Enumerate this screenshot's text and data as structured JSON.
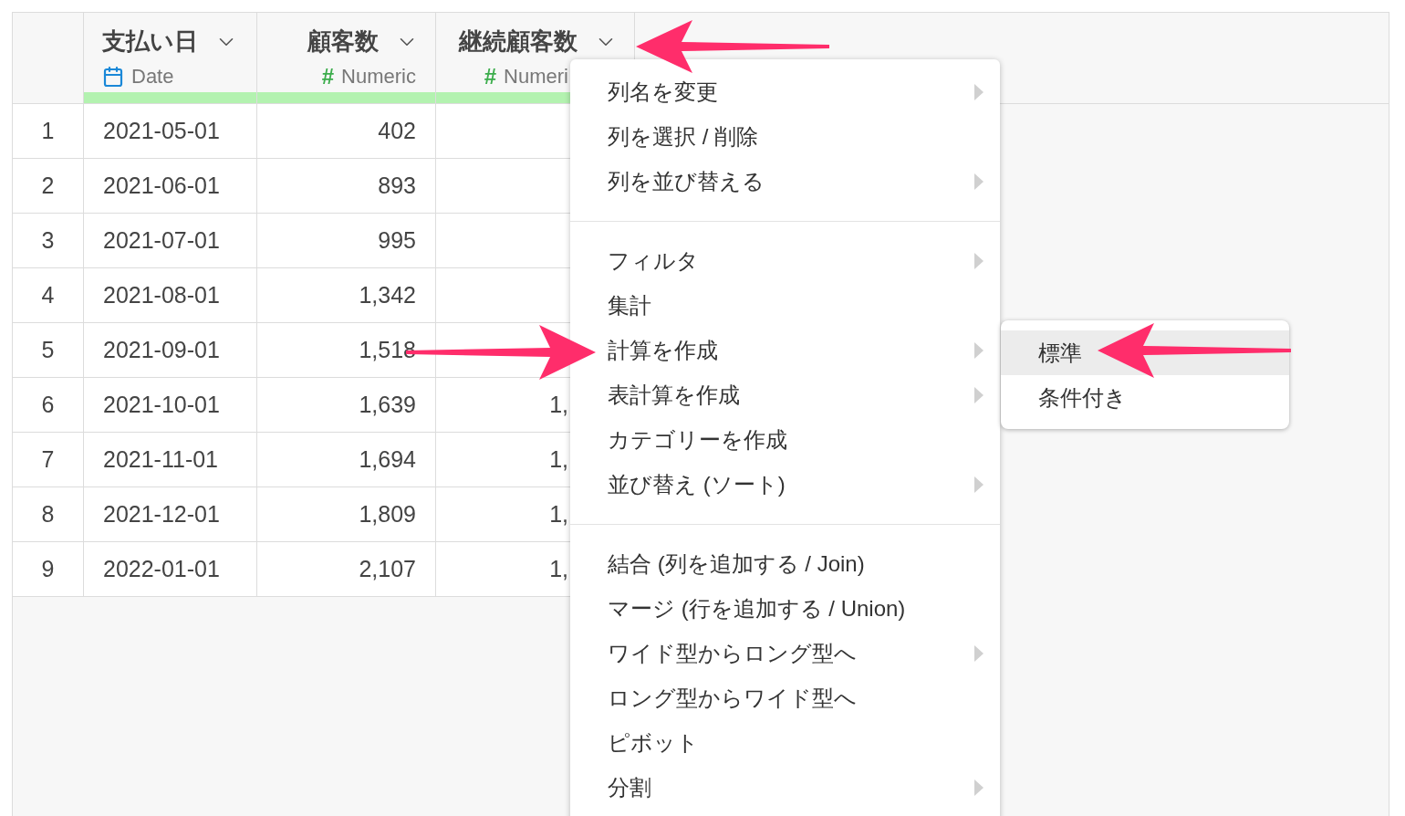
{
  "table": {
    "columns": [
      {
        "name": "支払い日",
        "type_label": "Date",
        "kind": "date"
      },
      {
        "name": "顧客数",
        "type_label": "Numeric",
        "kind": "numeric",
        "symbol": "#"
      },
      {
        "name": "継続顧客数",
        "type_label": "Numeri",
        "kind": "numeric",
        "symbol": "#"
      }
    ],
    "rows": [
      {
        "index": "1",
        "cells": [
          "2021-05-01",
          "402",
          ""
        ]
      },
      {
        "index": "2",
        "cells": [
          "2021-06-01",
          "893",
          ""
        ]
      },
      {
        "index": "3",
        "cells": [
          "2021-07-01",
          "995",
          ""
        ]
      },
      {
        "index": "4",
        "cells": [
          "2021-08-01",
          "1,342",
          ""
        ]
      },
      {
        "index": "5",
        "cells": [
          "2021-09-01",
          "1,518",
          ""
        ]
      },
      {
        "index": "6",
        "cells": [
          "2021-10-01",
          "1,639",
          "1,"
        ]
      },
      {
        "index": "7",
        "cells": [
          "2021-11-01",
          "1,694",
          "1,"
        ]
      },
      {
        "index": "8",
        "cells": [
          "2021-12-01",
          "1,809",
          "1,"
        ]
      },
      {
        "index": "9",
        "cells": [
          "2022-01-01",
          "2,107",
          "1,"
        ]
      }
    ]
  },
  "context_menu": {
    "groups": [
      [
        {
          "label": "列名を変更",
          "submenu": true
        },
        {
          "label": "列を選択 / 削除",
          "submenu": false
        },
        {
          "label": "列を並び替える",
          "submenu": true
        }
      ],
      [
        {
          "label": "フィルタ",
          "submenu": true
        },
        {
          "label": "集計",
          "submenu": false
        },
        {
          "label": "計算を作成",
          "submenu": true
        },
        {
          "label": "表計算を作成",
          "submenu": true
        },
        {
          "label": "カテゴリーを作成",
          "submenu": false
        },
        {
          "label": "並び替え (ソート)",
          "submenu": true
        }
      ],
      [
        {
          "label": "結合 (列を追加する / Join)",
          "submenu": false
        },
        {
          "label": "マージ (行を追加する / Union)",
          "submenu": false
        },
        {
          "label": "ワイド型からロング型へ",
          "submenu": true
        },
        {
          "label": "ロング型からワイド型へ",
          "submenu": false
        },
        {
          "label": "ピボット",
          "submenu": false
        },
        {
          "label": "分割",
          "submenu": true
        }
      ]
    ]
  },
  "submenu": {
    "items": [
      {
        "label": "標準",
        "selected": true
      },
      {
        "label": "条件付き",
        "selected": false
      }
    ]
  }
}
